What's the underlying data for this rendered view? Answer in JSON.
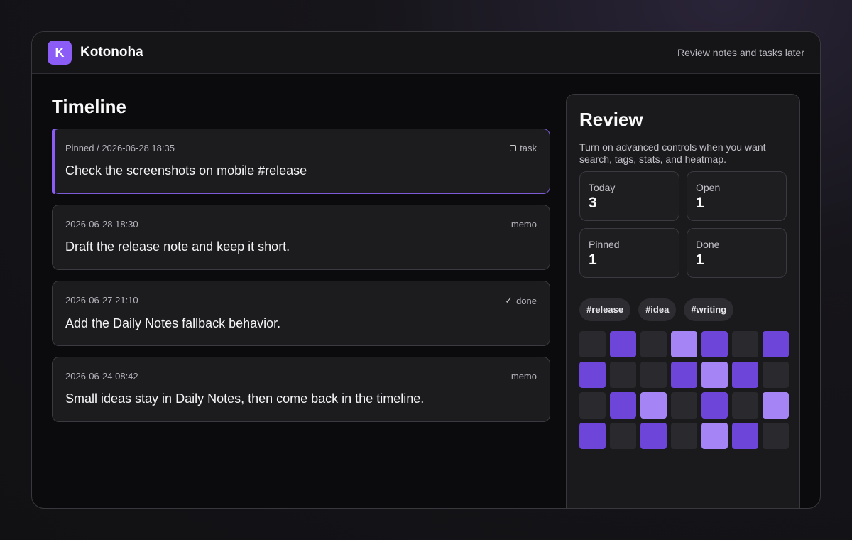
{
  "app": {
    "logo_letter": "K",
    "name": "Kotonoha",
    "hint": "Review notes and tasks later"
  },
  "timeline": {
    "title": "Timeline",
    "items": [
      {
        "meta": "Pinned / 2026-06-28 18:35",
        "kind": "task",
        "kind_icon": "checkbox-icon",
        "text": "Check the screenshots on mobile #release",
        "pinned": true
      },
      {
        "meta": "2026-06-28 18:30",
        "kind": "memo",
        "kind_icon": "",
        "text": "Draft the release note and keep it short.",
        "pinned": false
      },
      {
        "meta": "2026-06-27 21:10",
        "kind": "done",
        "kind_icon": "check-icon",
        "text": "Add the Daily Notes fallback behavior.",
        "pinned": false
      },
      {
        "meta": "2026-06-24 08:42",
        "kind": "memo",
        "kind_icon": "",
        "text": "Small ideas stay in Daily Notes, then come back in the timeline.",
        "pinned": false
      }
    ]
  },
  "review": {
    "title": "Review",
    "description": "Turn on advanced controls when you want search, tags, stats, and heatmap.",
    "stats": [
      {
        "label": "Today",
        "value": "3"
      },
      {
        "label": "Open",
        "value": "1"
      },
      {
        "label": "Pinned",
        "value": "1"
      },
      {
        "label": "Done",
        "value": "1"
      }
    ],
    "tags": [
      "#release",
      "#idea",
      "#writing"
    ],
    "heatmap": [
      [
        0,
        1,
        0,
        2,
        1,
        0,
        1
      ],
      [
        1,
        0,
        0,
        1,
        2,
        1,
        0
      ],
      [
        0,
        1,
        2,
        0,
        1,
        0,
        2
      ],
      [
        1,
        0,
        1,
        0,
        2,
        1,
        0
      ]
    ]
  },
  "colors": {
    "accent": "#8b5cf6",
    "heat_empty": "#2a2a2e",
    "heat_mid": "#6d45d8",
    "heat_high": "#a585f5"
  }
}
